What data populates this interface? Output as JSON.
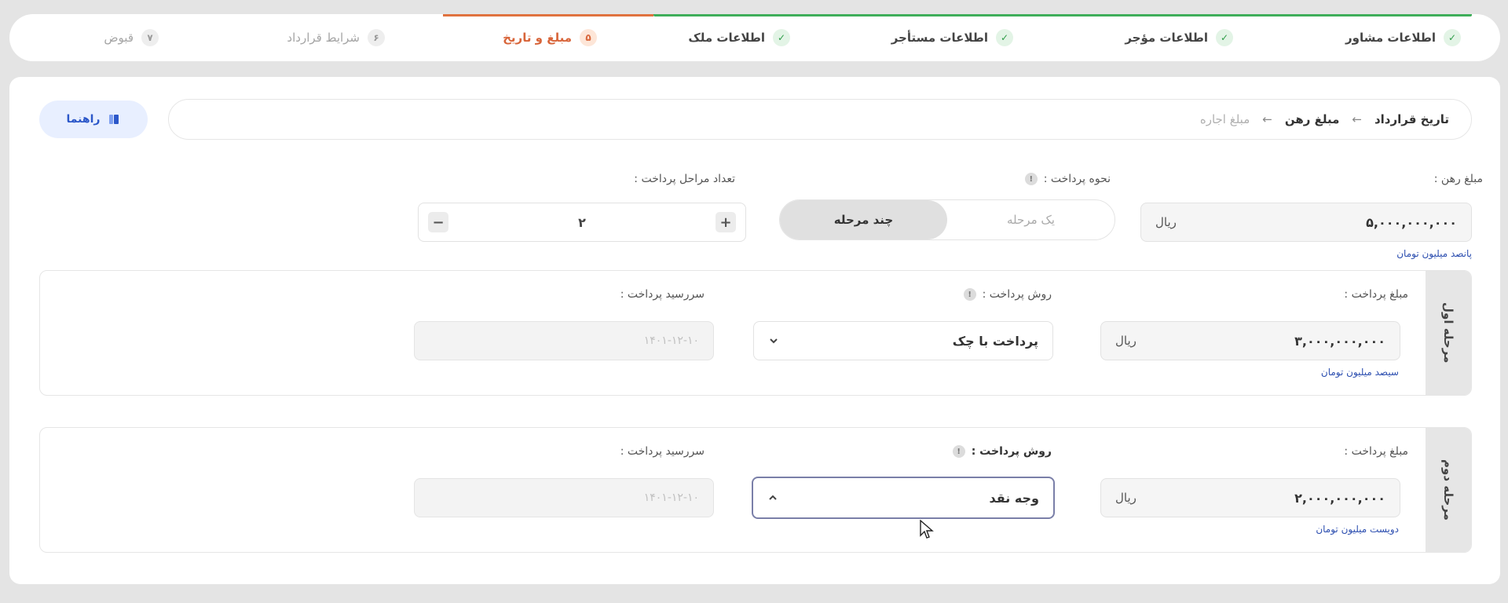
{
  "stepper": {
    "steps": [
      {
        "number": "✓",
        "label": "اطلاعات مشاور",
        "state": "done"
      },
      {
        "number": "✓",
        "label": "اطلاعات مؤجر",
        "state": "done"
      },
      {
        "number": "✓",
        "label": "اطلاعات مستأجر",
        "state": "done"
      },
      {
        "number": "✓",
        "label": "اطلاعات ملک",
        "state": "done"
      },
      {
        "number": "۵",
        "label": "مبلغ و تاریخ",
        "state": "active"
      },
      {
        "number": "۶",
        "label": "شرایط قرارداد",
        "state": "pending"
      },
      {
        "number": "۷",
        "label": "قبوض",
        "state": "pending"
      }
    ]
  },
  "breadcrumb": {
    "items": [
      "تاریخ قرارداد",
      "مبلغ رهن",
      "مبلغ اجاره"
    ],
    "arrow": "←"
  },
  "guide_button": {
    "label": "راهنما"
  },
  "deposit": {
    "label": "مبلغ رهن :",
    "value": "۵,۰۰۰,۰۰۰,۰۰۰",
    "unit": "ریال",
    "hint": "پانصد میلیون تومان"
  },
  "payment_type": {
    "label": "نحوه پرداخت :",
    "info": "!",
    "options": [
      "یک مرحله",
      "چند مرحله"
    ],
    "selected": "چند مرحله"
  },
  "stage_count": {
    "label": "تعداد مراحل پرداخت :",
    "value": "۲",
    "plus": "+",
    "minus": "−"
  },
  "stages": [
    {
      "title": "مرحله اول",
      "amount_label": "مبلغ پرداخت :",
      "amount": "۳,۰۰۰,۰۰۰,۰۰۰",
      "unit": "ریال",
      "hint": "سیصد میلیون تومان",
      "method_label": "روش پرداخت :",
      "method": "پرداخت با چک",
      "due_label": "سررسید پرداخت :",
      "due": "۱۴۰۱-۱۲-۱۰"
    },
    {
      "title": "مرحله دوم",
      "amount_label": "مبلغ پرداخت :",
      "amount": "۲,۰۰۰,۰۰۰,۰۰۰",
      "unit": "ریال",
      "hint": "دویست میلیون تومان",
      "method_label": "روش پرداخت :",
      "method": "وجه نقد",
      "due_label": "سررسید پرداخت :",
      "due": "۱۴۰۱-۱۲-۱۰"
    }
  ],
  "colors": {
    "done": "#3fae5a",
    "active": "#d8653a",
    "link": "#2d4fb0",
    "guide_bg": "#e8efff"
  }
}
